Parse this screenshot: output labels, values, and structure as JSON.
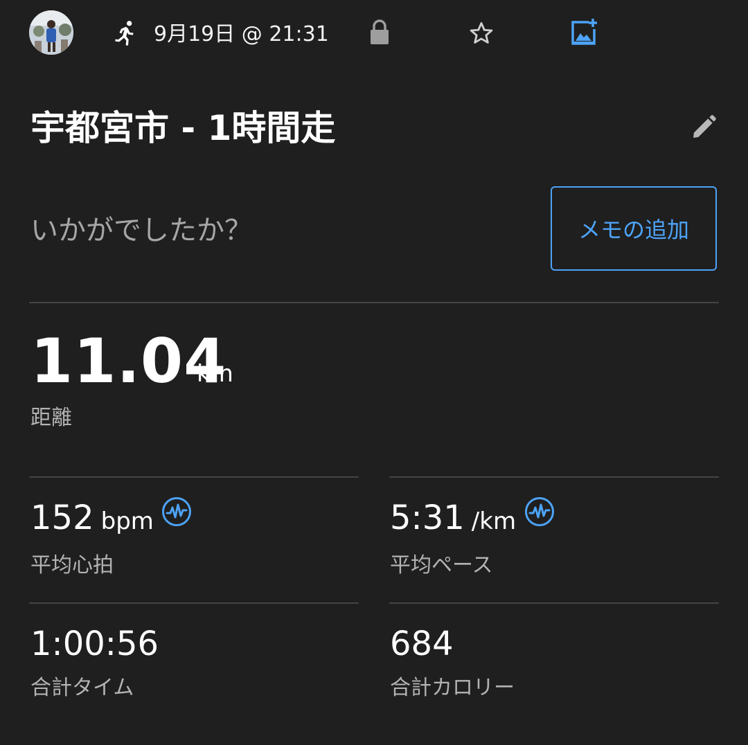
{
  "header": {
    "date_time": "9月19日 @ 21:31",
    "icons": {
      "activity": "running-icon",
      "privacy": "lock-icon",
      "favorite": "star-icon",
      "photo": "add-photo-icon",
      "edit": "pencil-icon",
      "heart_rate_source": "heart-rate-monitor-icon"
    }
  },
  "activity": {
    "title": "宇都宮市 - 1時間走"
  },
  "memo": {
    "prompt": "いかがでしたか？",
    "add_button_label": "メモの追加"
  },
  "distance": {
    "value": "11.04",
    "unit": "km",
    "label": "距離"
  },
  "stats": {
    "avg_hr": {
      "value": "152",
      "unit": "bpm",
      "label": "平均心拍"
    },
    "avg_pace": {
      "value": "5:31",
      "unit": "/km",
      "label": "平均ペース"
    },
    "total_time": {
      "value": "1:00:56",
      "label": "合計タイム"
    },
    "total_calories": {
      "value": "684",
      "label": "合計カロリー"
    }
  },
  "colors": {
    "background": "#1f1f1f",
    "accent": "#4da3f7",
    "secondary_text": "#b3b3b3",
    "divider": "#444444"
  }
}
